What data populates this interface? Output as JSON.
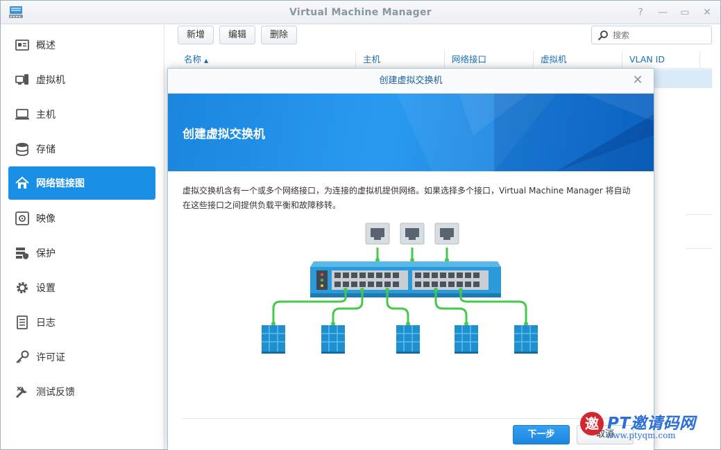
{
  "window": {
    "title": "Virtual Machine Manager"
  },
  "sidebar": {
    "items": [
      {
        "label": "概述",
        "icon": "overview-icon"
      },
      {
        "label": "虚拟机",
        "icon": "vm-icon"
      },
      {
        "label": "主机",
        "icon": "host-icon"
      },
      {
        "label": "存储",
        "icon": "storage-icon"
      },
      {
        "label": "网络链接图",
        "icon": "network-icon",
        "active": true
      },
      {
        "label": "映像",
        "icon": "image-icon"
      },
      {
        "label": "保护",
        "icon": "protect-icon"
      },
      {
        "label": "设置",
        "icon": "gear-icon"
      },
      {
        "label": "日志",
        "icon": "log-icon"
      },
      {
        "label": "许可证",
        "icon": "license-icon"
      },
      {
        "label": "测试反馈",
        "icon": "feedback-icon"
      }
    ]
  },
  "toolbar": {
    "add": "新增",
    "edit": "编辑",
    "delete": "删除",
    "search_placeholder": "搜索"
  },
  "table": {
    "columns": [
      "名称",
      "主机",
      "网络接口",
      "虚拟机",
      "VLAN ID"
    ]
  },
  "dialog": {
    "title": "创建虚拟交换机",
    "banner_title": "创建虚拟交换机",
    "description_line1": "虚拟交换机含有一个或多个网络接口，为连接的虚拟机提供网络。如果选择多个接口，Virtual Machine Manager 将自动",
    "description_line2": "在这些接口之间提供负载平衡和故障移转。",
    "next": "下一步",
    "cancel": "取消"
  },
  "watermark": {
    "text": "PT邀请码网",
    "url": "www.ptyqm.com"
  },
  "colors": {
    "accent": "#1a8fe6",
    "banner": "#1a86de",
    "port": "#46c84a"
  }
}
